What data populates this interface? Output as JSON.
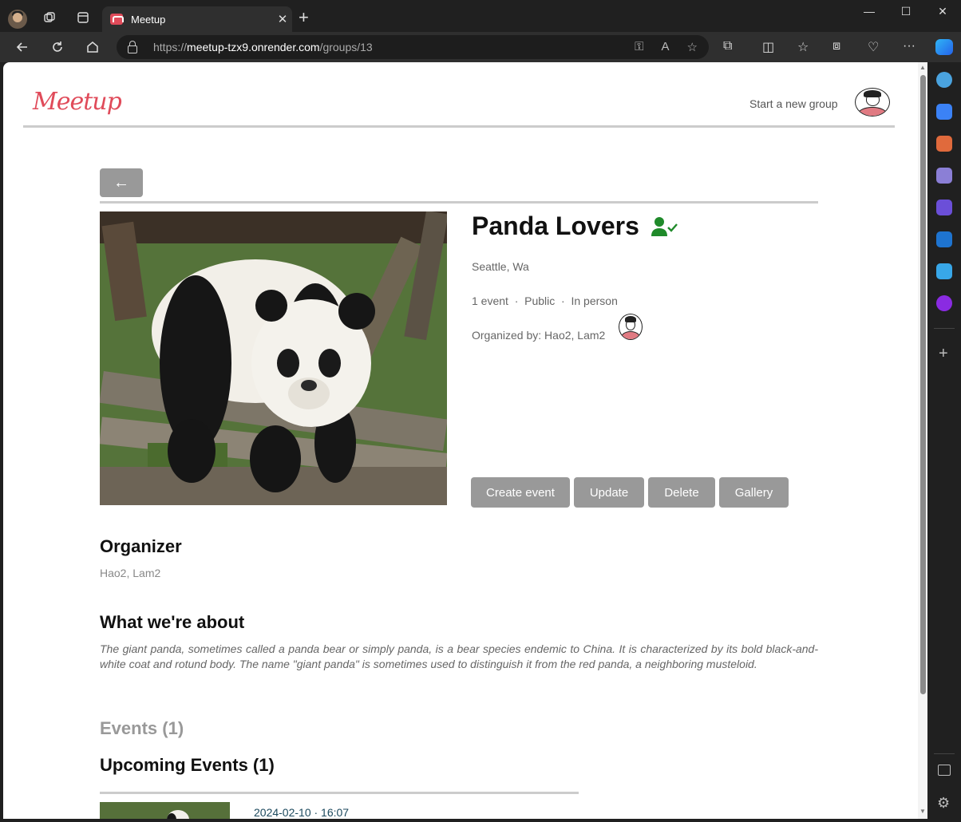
{
  "browser": {
    "tab_title": "Meetup",
    "tab_close": "✕",
    "new_tab": "+",
    "url_prefix": "https://",
    "url_domain": "meetup-tzx9.onrender.com",
    "url_path": "/groups/13",
    "window_controls": {
      "minimize": "—",
      "maximize": "☐",
      "close": "✕"
    }
  },
  "header": {
    "logo": "Meetup",
    "start_group": "Start a new group"
  },
  "group": {
    "back_arrow": "←",
    "name": "Panda Lovers",
    "location": "Seattle, Wa",
    "meta": "1 event  ·  Public  ·  In person",
    "organized_by": "Organized by: Hao2, Lam2",
    "actions": {
      "create_event": "Create event",
      "update": "Update",
      "delete": "Delete",
      "gallery": "Gallery"
    }
  },
  "organizer": {
    "heading": "Organizer",
    "names": "Hao2, Lam2"
  },
  "about": {
    "heading": "What we're about",
    "text": "The giant panda, sometimes called a panda bear or simply panda, is a bear species endemic to China. It is characterized by its bold black-and-white coat and rotund body. The name \"giant panda\" is sometimes used to distinguish it from the red panda, a neighboring musteloid."
  },
  "events": {
    "count_label": "Events (1)",
    "upcoming_label": "Upcoming Events (1)",
    "items": [
      {
        "datetime": "2024-02-10 · 16:07"
      }
    ]
  },
  "colors": {
    "brand": "#e04b5a",
    "button": "#999999",
    "member_icon": "#1f8a2a",
    "event_date": "#1d4a5e"
  }
}
